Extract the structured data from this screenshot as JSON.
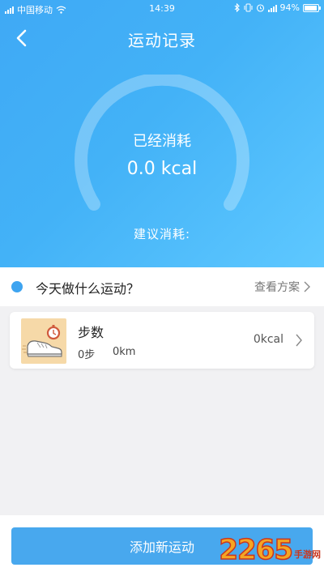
{
  "status_bar": {
    "carrier": "中国移动",
    "time": "14:39",
    "battery": "94%"
  },
  "header": {
    "title": "运动记录",
    "back_icon": "chevron-left-icon"
  },
  "summary": {
    "consumed_label": "已经消耗",
    "consumed_value": "0.0 kcal",
    "suggest_label": "建议消耗:"
  },
  "today": {
    "title": "今天做什么运动？",
    "plan_link": "查看方案"
  },
  "exercises": [
    {
      "name": "步数",
      "steps": "0步",
      "distance": "0km",
      "kcal": "0kcal",
      "icon": "sneaker-stopwatch-icon"
    }
  ],
  "footer": {
    "add_button": "添加新运动"
  },
  "watermark": {
    "big": "2265",
    "small": "手游网"
  },
  "colors": {
    "hero_gradient_start": "#3fa9f5",
    "hero_gradient_end": "#5ec8ff",
    "accent_blue": "#48a8ee",
    "thumb_bg": "#f6d9a8"
  }
}
